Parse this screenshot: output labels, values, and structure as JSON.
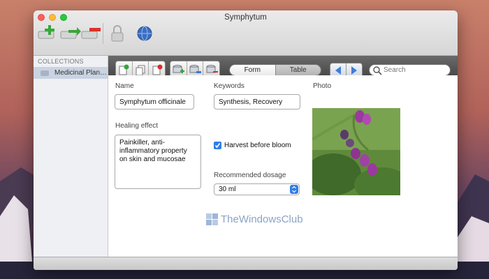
{
  "window": {
    "title": "Symphytum"
  },
  "sidebar": {
    "header": "COLLECTIONS",
    "items": [
      {
        "label": "Medicinal Plan…"
      }
    ]
  },
  "view_switch": {
    "form_label": "Form",
    "table_label": "Table",
    "selected": "Form"
  },
  "search": {
    "placeholder": "Search"
  },
  "form": {
    "name": {
      "label": "Name",
      "value": "Symphytum officinale"
    },
    "keywords": {
      "label": "Keywords",
      "value": "Synthesis, Recovery"
    },
    "photo": {
      "label": "Photo"
    },
    "healing_effect": {
      "label": "Healing effect",
      "lines": [
        "Painkiller, anti-",
        "inflammatory property",
        "on skin and mucosae"
      ]
    },
    "harvest": {
      "label": "Harvest before bloom",
      "checked": true
    },
    "dosage": {
      "label": "Recommended dosage",
      "value": "30 ml"
    }
  },
  "watermark": {
    "text": "TheWindowsClub"
  },
  "colors": {
    "accent": "#2f7ee8",
    "toolbar_dark": "#555555",
    "selection": "#c9d3e2"
  }
}
